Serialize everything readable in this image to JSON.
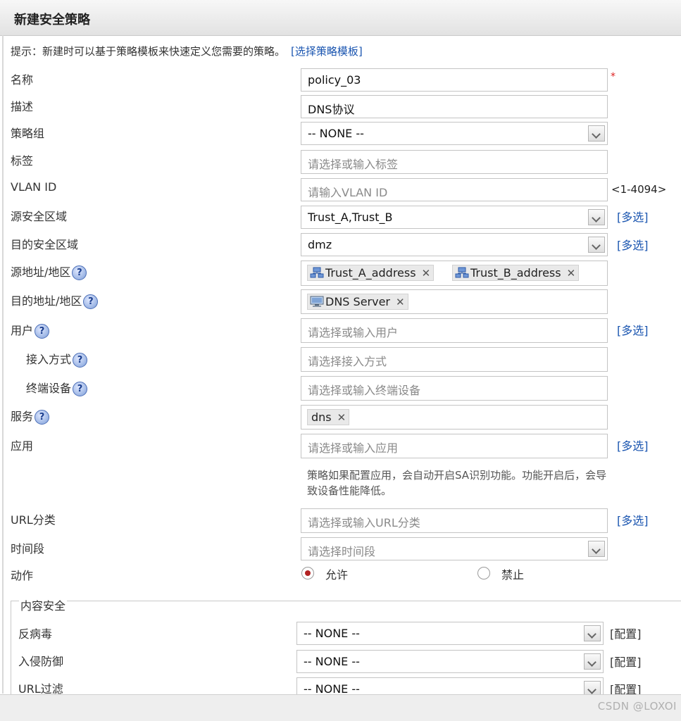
{
  "dialog": {
    "title": "新建安全策略"
  },
  "hint": {
    "text": "提示：新建时可以基于策略模板来快速定义您需要的策略。",
    "link": "[选择策略模板]"
  },
  "fields": {
    "name": {
      "label": "名称",
      "value": "policy_03",
      "required_mark": "*"
    },
    "description": {
      "label": "描述",
      "value": "DNS协议"
    },
    "policy_group": {
      "label": "策略组",
      "value": "-- NONE --"
    },
    "tags": {
      "label": "标签",
      "placeholder": "请选择或输入标签"
    },
    "vlan_id": {
      "label": "VLAN ID",
      "placeholder": "请输入VLAN ID",
      "range": "<1-4094>"
    },
    "src_zone": {
      "label": "源安全区域",
      "value": "Trust_A,Trust_B",
      "multi": "[多选]"
    },
    "dst_zone": {
      "label": "目的安全区域",
      "value": "dmz",
      "multi": "[多选]"
    },
    "src_addr": {
      "label": "源地址/地区",
      "tags": [
        "Trust_A_address",
        "Trust_B_address"
      ]
    },
    "dst_addr": {
      "label": "目的地址/地区",
      "tags": [
        "DNS Server"
      ]
    },
    "user": {
      "label": "用户",
      "placeholder": "请选择或输入用户",
      "multi": "[多选]"
    },
    "access": {
      "label": "接入方式",
      "placeholder": "请选择接入方式"
    },
    "terminal": {
      "label": "终端设备",
      "placeholder": "请选择或输入终端设备"
    },
    "service": {
      "label": "服务",
      "tags": [
        "dns"
      ]
    },
    "application": {
      "label": "应用",
      "placeholder": "请选择或输入应用",
      "multi": "[多选]",
      "note": "策略如果配置应用，会自动开启SA识别功能。功能开启后，会导致设备性能降低。"
    },
    "url_category": {
      "label": "URL分类",
      "placeholder": "请选择或输入URL分类",
      "multi": "[多选]"
    },
    "time_range": {
      "label": "时间段",
      "placeholder": "请选择时间段"
    },
    "action": {
      "label": "动作",
      "options": [
        "允许",
        "禁止"
      ],
      "selected": "允许"
    }
  },
  "content_security": {
    "legend": "内容安全",
    "rows": [
      {
        "label": "反病毒",
        "value": "-- NONE --",
        "cfg": "[配置]"
      },
      {
        "label": "入侵防御",
        "value": "-- NONE --",
        "cfg": "[配置]"
      },
      {
        "label": "URL过滤",
        "value": "-- NONE --",
        "cfg": "[配置]"
      }
    ]
  },
  "watermark": "CSDN @LOXOI",
  "colors": {
    "link": "#1a55b0",
    "required": "#d22222",
    "radio_selected": "#b22222"
  },
  "icons": {
    "help": "help-icon",
    "network_object": "network-group-icon",
    "server": "monitor-icon",
    "remove": "close-icon"
  }
}
